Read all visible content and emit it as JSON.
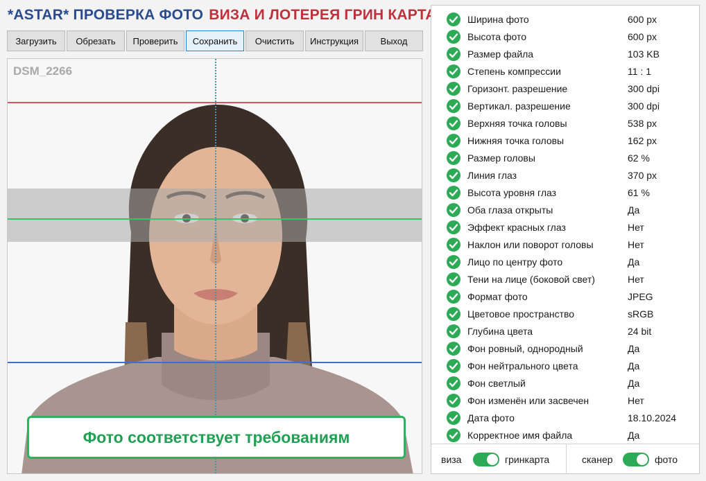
{
  "header": {
    "title_part1": "*ASTAR* ПРОВЕРКА ФОТО",
    "title_part2": "ВИЗА И ЛОТЕРЕЯ ГРИН КАРТА",
    "color_part1": "#2a4b8d",
    "color_part2": "#c0303a"
  },
  "toolbar": {
    "buttons": [
      {
        "label": "Загрузить"
      },
      {
        "label": "Обрезать"
      },
      {
        "label": "Проверить"
      },
      {
        "label": "Сохранить",
        "active": true
      },
      {
        "label": "Очистить"
      },
      {
        "label": "Инструкция"
      },
      {
        "label": "Выход"
      }
    ]
  },
  "photo": {
    "file_name": "DSM_2266",
    "status_text": "Фото соответствует требованиям",
    "status_color": "#2fb060"
  },
  "checks": [
    {
      "label": "Ширина фото",
      "value": "600 px",
      "status": "ok"
    },
    {
      "label": "Высота фото",
      "value": "600 px",
      "status": "ok"
    },
    {
      "label": "Размер файла",
      "value": "103 KB",
      "status": "ok"
    },
    {
      "label": "Степень компрессии",
      "value": "11 : 1",
      "status": "ok"
    },
    {
      "label": "Горизонт. разрешение",
      "value": "300 dpi",
      "status": "ok"
    },
    {
      "label": "Вертикал. разрешение",
      "value": "300 dpi",
      "status": "ok"
    },
    {
      "label": "Верхняя точка головы",
      "value": "538 px",
      "status": "ok"
    },
    {
      "label": "Нижняя точка головы",
      "value": "162 px",
      "status": "ok"
    },
    {
      "label": "Размер головы",
      "value": "62 %",
      "status": "ok"
    },
    {
      "label": "Линия глаз",
      "value": "370 px",
      "status": "ok"
    },
    {
      "label": "Высота уровня глаз",
      "value": "61 %",
      "status": "ok"
    },
    {
      "label": "Оба глаза открыты",
      "value": "Да",
      "status": "ok"
    },
    {
      "label": "Эффект красных глаз",
      "value": "Нет",
      "status": "ok"
    },
    {
      "label": "Наклон или поворот головы",
      "value": "Нет",
      "status": "ok"
    },
    {
      "label": "Лицо по центру фото",
      "value": "Да",
      "status": "ok"
    },
    {
      "label": "Тени на лице (боковой свет)",
      "value": "Нет",
      "status": "ok"
    },
    {
      "label": "Формат фото",
      "value": "JPEG",
      "status": "ok"
    },
    {
      "label": "Цветовое пространство",
      "value": "sRGB",
      "status": "ok"
    },
    {
      "label": "Глубина цвета",
      "value": "24 bit",
      "status": "ok"
    },
    {
      "label": "Фон ровный, однородный",
      "value": "Да",
      "status": "ok"
    },
    {
      "label": "Фон нейтрального цвета",
      "value": "Да",
      "status": "ok"
    },
    {
      "label": "Фон светлый",
      "value": "Да",
      "status": "ok"
    },
    {
      "label": "Фон изменён или засвечен",
      "value": "Нет",
      "status": "ok"
    },
    {
      "label": "Дата фото",
      "value": "18.10.2024",
      "status": "ok"
    },
    {
      "label": "Корректное имя файла",
      "value": "Да",
      "status": "ok"
    }
  ],
  "toggles": {
    "mode": {
      "left_label": "виза",
      "right_label": "гринкарта",
      "on": true
    },
    "source": {
      "left_label": "сканер",
      "right_label": "фото",
      "on": true
    }
  },
  "colors": {
    "ok_green": "#2daa55",
    "head_top_line": "#d9535f",
    "eye_line": "#3cc06a",
    "chin_line": "#3d6fd0",
    "center_line": "#3a9bb5"
  }
}
